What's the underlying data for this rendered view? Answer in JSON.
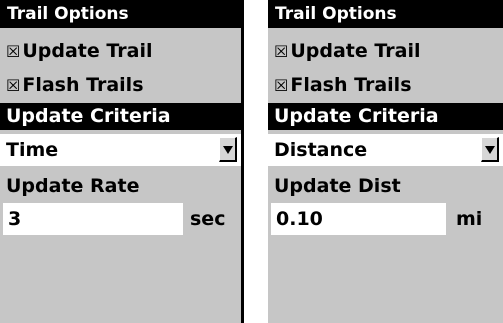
{
  "panels": [
    {
      "title": "Trail Options",
      "update_trail": {
        "checked": true,
        "label": "Update Trail"
      },
      "flash_trails": {
        "checked": true,
        "label": "Flash Trails"
      },
      "criteria_header": "Update Criteria",
      "criteria_value": "Time",
      "field_label": "Update Rate",
      "field_value": "3",
      "unit": "sec"
    },
    {
      "title": "Trail Options",
      "update_trail": {
        "checked": true,
        "label": "Update Trail"
      },
      "flash_trails": {
        "checked": true,
        "label": "Flash Trails"
      },
      "criteria_header": "Update Criteria",
      "criteria_value": "Distance",
      "field_label": "Update Dist",
      "field_value": "0.10",
      "unit": "mi"
    }
  ],
  "icons": {
    "checkbox": "checkbox-checked-icon",
    "dropdown": "dropdown-arrow-icon"
  },
  "colors": {
    "panel_bg": "#c6c6c6",
    "header_bg": "#000000",
    "field_bg": "#ffffff"
  }
}
